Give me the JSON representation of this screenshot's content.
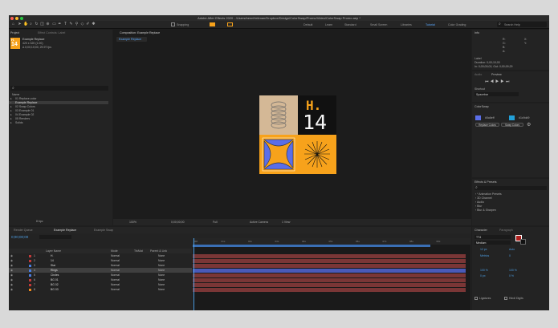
{
  "window": {
    "title": "Adobe After Effects 2020 - /Users/bennHeitman/Dropbox/Design/ColorSwap/Promo/Video/ColorSwap Promo.aep *",
    "traffic_colors": [
      "#ff5f57",
      "#febc2e",
      "#28c840"
    ]
  },
  "toolbar": {
    "snapping_label": "Snapping",
    "workspaces": [
      "Default",
      "Learn",
      "Standard",
      "Small Screen",
      "Libraries",
      "Tutorial",
      "Color Grading"
    ],
    "search_placeholder": "Search Help"
  },
  "project": {
    "tab": "Project",
    "effect_controls_tab": "Effect Controls: Label",
    "comp_name": "Example Replace",
    "comp_info": "420 x 320 (1.00)",
    "comp_info2": "Δ 0;00;10;00, 29.97 fps",
    "search_placeholder": "",
    "column_name": "Name",
    "items": [
      {
        "name": "01 Replace-color",
        "type": "folder"
      },
      {
        "name": "Example Replace",
        "type": "comp",
        "selected": true
      },
      {
        "name": "02 Swap Colors",
        "type": "folder"
      },
      {
        "name": "03 Example 01",
        "type": "folder"
      },
      {
        "name": "04 Example 02",
        "type": "folder"
      },
      {
        "name": "05 Renders",
        "type": "folder"
      },
      {
        "name": "Solids",
        "type": "folder"
      }
    ],
    "footer": "8 bpc"
  },
  "composition": {
    "tab": "Composition: Example Replace",
    "subtab": "Example Replace",
    "zoom": "100%",
    "timecode": "0;00;00;00",
    "quality": "Full",
    "camera": "Active Camera",
    "views": "1 View",
    "hero_text": "H.",
    "hero_number": "14",
    "accent": "#f7a21b"
  },
  "info": {
    "tab": "Info",
    "values": [
      "R:",
      "G:",
      "B:",
      "A:"
    ],
    "x_label": "X:",
    "y_label": "Y:",
    "clip_label": "Label",
    "clip_duration": "Duration: 0;00;10;00",
    "clip_in": "In: 0;00;00;00, Out: 0;00;09;29"
  },
  "audio": {
    "tab": "Audio"
  },
  "preview": {
    "tab": "Preview",
    "shortcut_label": "Shortcut",
    "shortcut_value": "Spacebar"
  },
  "colorswap": {
    "tab": "ColorSwap",
    "color1": "#5a6ee8",
    "hex1": "#5a6eff",
    "color2": "#22a0d8",
    "hex2": "#1c9dd9",
    "replace_btn": "Replace Colors",
    "swap_btn": "Swap Colors"
  },
  "effects": {
    "tab": "Effects & Presets",
    "search_placeholder": "",
    "items": [
      "* Animation Presets",
      "3D Channel",
      "Audio",
      "Blur",
      "Blur & Sharpen"
    ]
  },
  "character": {
    "tab": "Character",
    "paragraph_tab": "Paragraph",
    "font": "TT4",
    "weight": "Medium",
    "size": "12 px",
    "leading": "Auto",
    "tracking": "0",
    "kerning": "Metrics",
    "scale_v": "100 %",
    "scale_h": "100 %",
    "baseline": "0 px",
    "tsume": "0 %",
    "ligatures": "Ligatures",
    "hindi": "Hindi Digits"
  },
  "timeline": {
    "tabs": [
      "Render Queue",
      "Example Replace",
      "Example Swap"
    ],
    "timecode": "0;00;00;00",
    "col_source": "Layer Name",
    "col_mode": "Mode",
    "col_trkmat": "TrkMat",
    "col_parent": "Parent & Link",
    "rulers": [
      "00f",
      "01s",
      "02s",
      "03s",
      "04s",
      "05s",
      "06s",
      "07s",
      "08s",
      "09s"
    ],
    "layers": [
      {
        "num": "1",
        "name": "H.",
        "mode": "Normal",
        "parent": "None",
        "label": "#c13a3a",
        "bar": "#7a3636"
      },
      {
        "num": "2",
        "name": "14",
        "mode": "Normal",
        "parent": "None",
        "label": "#c13a3a",
        "bar": "#7a3636"
      },
      {
        "num": "3",
        "name": "Star",
        "mode": "Normal",
        "parent": "None",
        "label": "#4a7ee0",
        "bar": "#7a3636"
      },
      {
        "num": "4",
        "name": "Rings",
        "mode": "Normal",
        "parent": "None",
        "label": "#4a7ee0",
        "bar": "#4a5ab8",
        "selected": true
      },
      {
        "num": "5",
        "name": "Circles",
        "mode": "Normal",
        "parent": "None",
        "label": "#4a7ee0",
        "bar": "#7a3636"
      },
      {
        "num": "6",
        "name": "BG 01",
        "mode": "Normal",
        "parent": "None",
        "label": "#c13a3a",
        "bar": "#7a3636"
      },
      {
        "num": "7",
        "name": "BG 02",
        "mode": "Normal",
        "parent": "None",
        "label": "#c13a3a",
        "bar": "#7a3636"
      },
      {
        "num": "8",
        "name": "BG 03",
        "mode": "Normal",
        "parent": "None",
        "label": "#f08a1c",
        "bar": "#7a3636"
      }
    ]
  }
}
